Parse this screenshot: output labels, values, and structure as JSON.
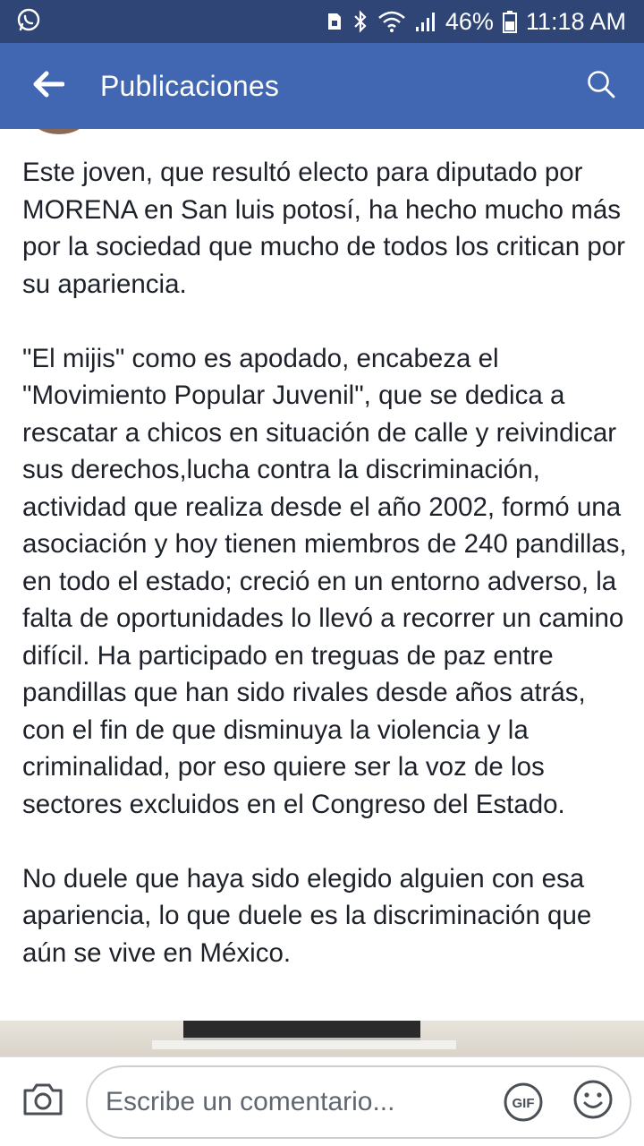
{
  "status_bar": {
    "battery": "46%",
    "time": "11:18 AM",
    "icons": [
      "whatsapp-icon",
      "sim-lock-icon",
      "bluetooth-icon",
      "wifi-icon",
      "signal-icon",
      "battery-icon"
    ]
  },
  "app_bar": {
    "title": "Publicaciones",
    "back_icon": "arrow-left-icon",
    "search_icon": "search-icon"
  },
  "post": {
    "paragraphs": [
      "Este joven, que resultó electo para diputado por MORENA en San luis potosí, ha hecho mucho más por la sociedad que mucho de todos los critican por su apariencia.",
      "\"El mijis\" como es apodado, encabeza el \"Movimiento Popular Juvenil\", que se dedica a rescatar a chicos en situación de calle y reivindicar sus derechos,lucha contra la discriminación, actividad que realiza desde el año 2002, formó una asociación y hoy tienen miembros de 240 pandillas, en todo el estado; creció en un entorno adverso, la falta de oportunidades lo llevó a recorrer un camino difícil. Ha participado en treguas de paz entre pandillas que han sido rivales desde años atrás, con el fin de que disminuya la violencia y la criminalidad, por eso quiere ser la voz de los sectores excluidos en el Congreso del Estado.",
      "No duele que haya sido elegido alguien con esa apariencia, lo que duele es la discriminación que aún se vive en México."
    ]
  },
  "comment_bar": {
    "placeholder": "Escribe un comentario...",
    "camera_icon": "camera-icon",
    "gif_label": "GIF",
    "emoji_icon": "emoji-icon"
  },
  "colors": {
    "status_bar": "#2f4575",
    "app_bar": "#4267b2",
    "text": "#1d2129",
    "placeholder": "#606770"
  }
}
